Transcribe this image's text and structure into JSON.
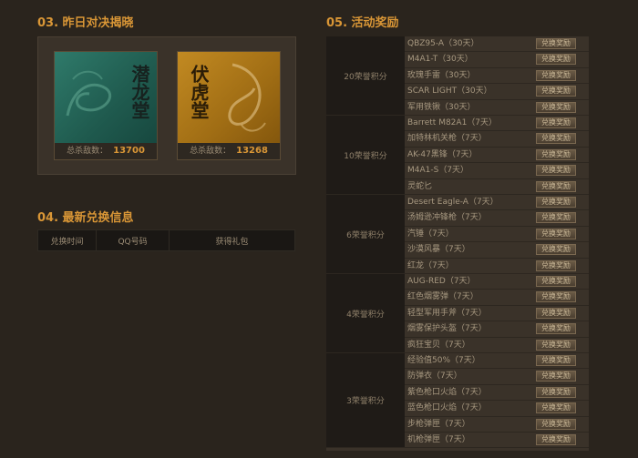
{
  "sections": {
    "s03": {
      "title": "03. 昨日对决揭晓"
    },
    "s04": {
      "title": "04. 最新兑换信息"
    },
    "s05": {
      "title": "05. 活动奖励"
    }
  },
  "duel": {
    "kill_label": "总杀敌数：",
    "cards": [
      {
        "calligraphy": "潜龙堂",
        "kills": "13700",
        "color": "#2f7a6a"
      },
      {
        "calligraphy": "伏虎堂",
        "kills": "13268",
        "color": "#c28a22"
      }
    ]
  },
  "exchange_table": {
    "headers": [
      "兑换时间",
      "QQ号码",
      "获得礼包"
    ]
  },
  "rewards": {
    "button_label": "兑换奖励",
    "groups": [
      {
        "label": "20荣誉积分",
        "items": [
          "QBZ95-A（30天）",
          "M4A1-T（30天）",
          "玫瑰手雷（30天）",
          "SCAR LIGHT（30天）",
          "军用铁锹（30天）"
        ]
      },
      {
        "label": "10荣誉积分",
        "items": [
          "Barrett M82A1（7天）",
          "加特林机关枪（7天）",
          "AK-47黑锋（7天）",
          "M4A1-S（7天）",
          "灵蛇匕"
        ]
      },
      {
        "label": "6荣誉积分",
        "items": [
          "Desert Eagle-A（7天）",
          "汤姆逊冲锋枪（7天）",
          "汽锤（7天）",
          "沙漠风暴（7天）",
          "红龙（7天）"
        ]
      },
      {
        "label": "4荣誉积分",
        "items": [
          "AUG-RED（7天）",
          "红色烟雾弹（7天）",
          "轻型军用手斧（7天）",
          "烟雾保护头盔（7天）",
          "疯狂宝贝（7天）"
        ]
      },
      {
        "label": "3荣誉积分",
        "items": [
          "经验值50%（7天）",
          "防弹衣（7天）",
          "紫色枪口火焰（7天）",
          "蓝色枪口火焰（7天）",
          "步枪弹匣（7天）",
          "机枪弹匣（7天）"
        ]
      }
    ]
  }
}
